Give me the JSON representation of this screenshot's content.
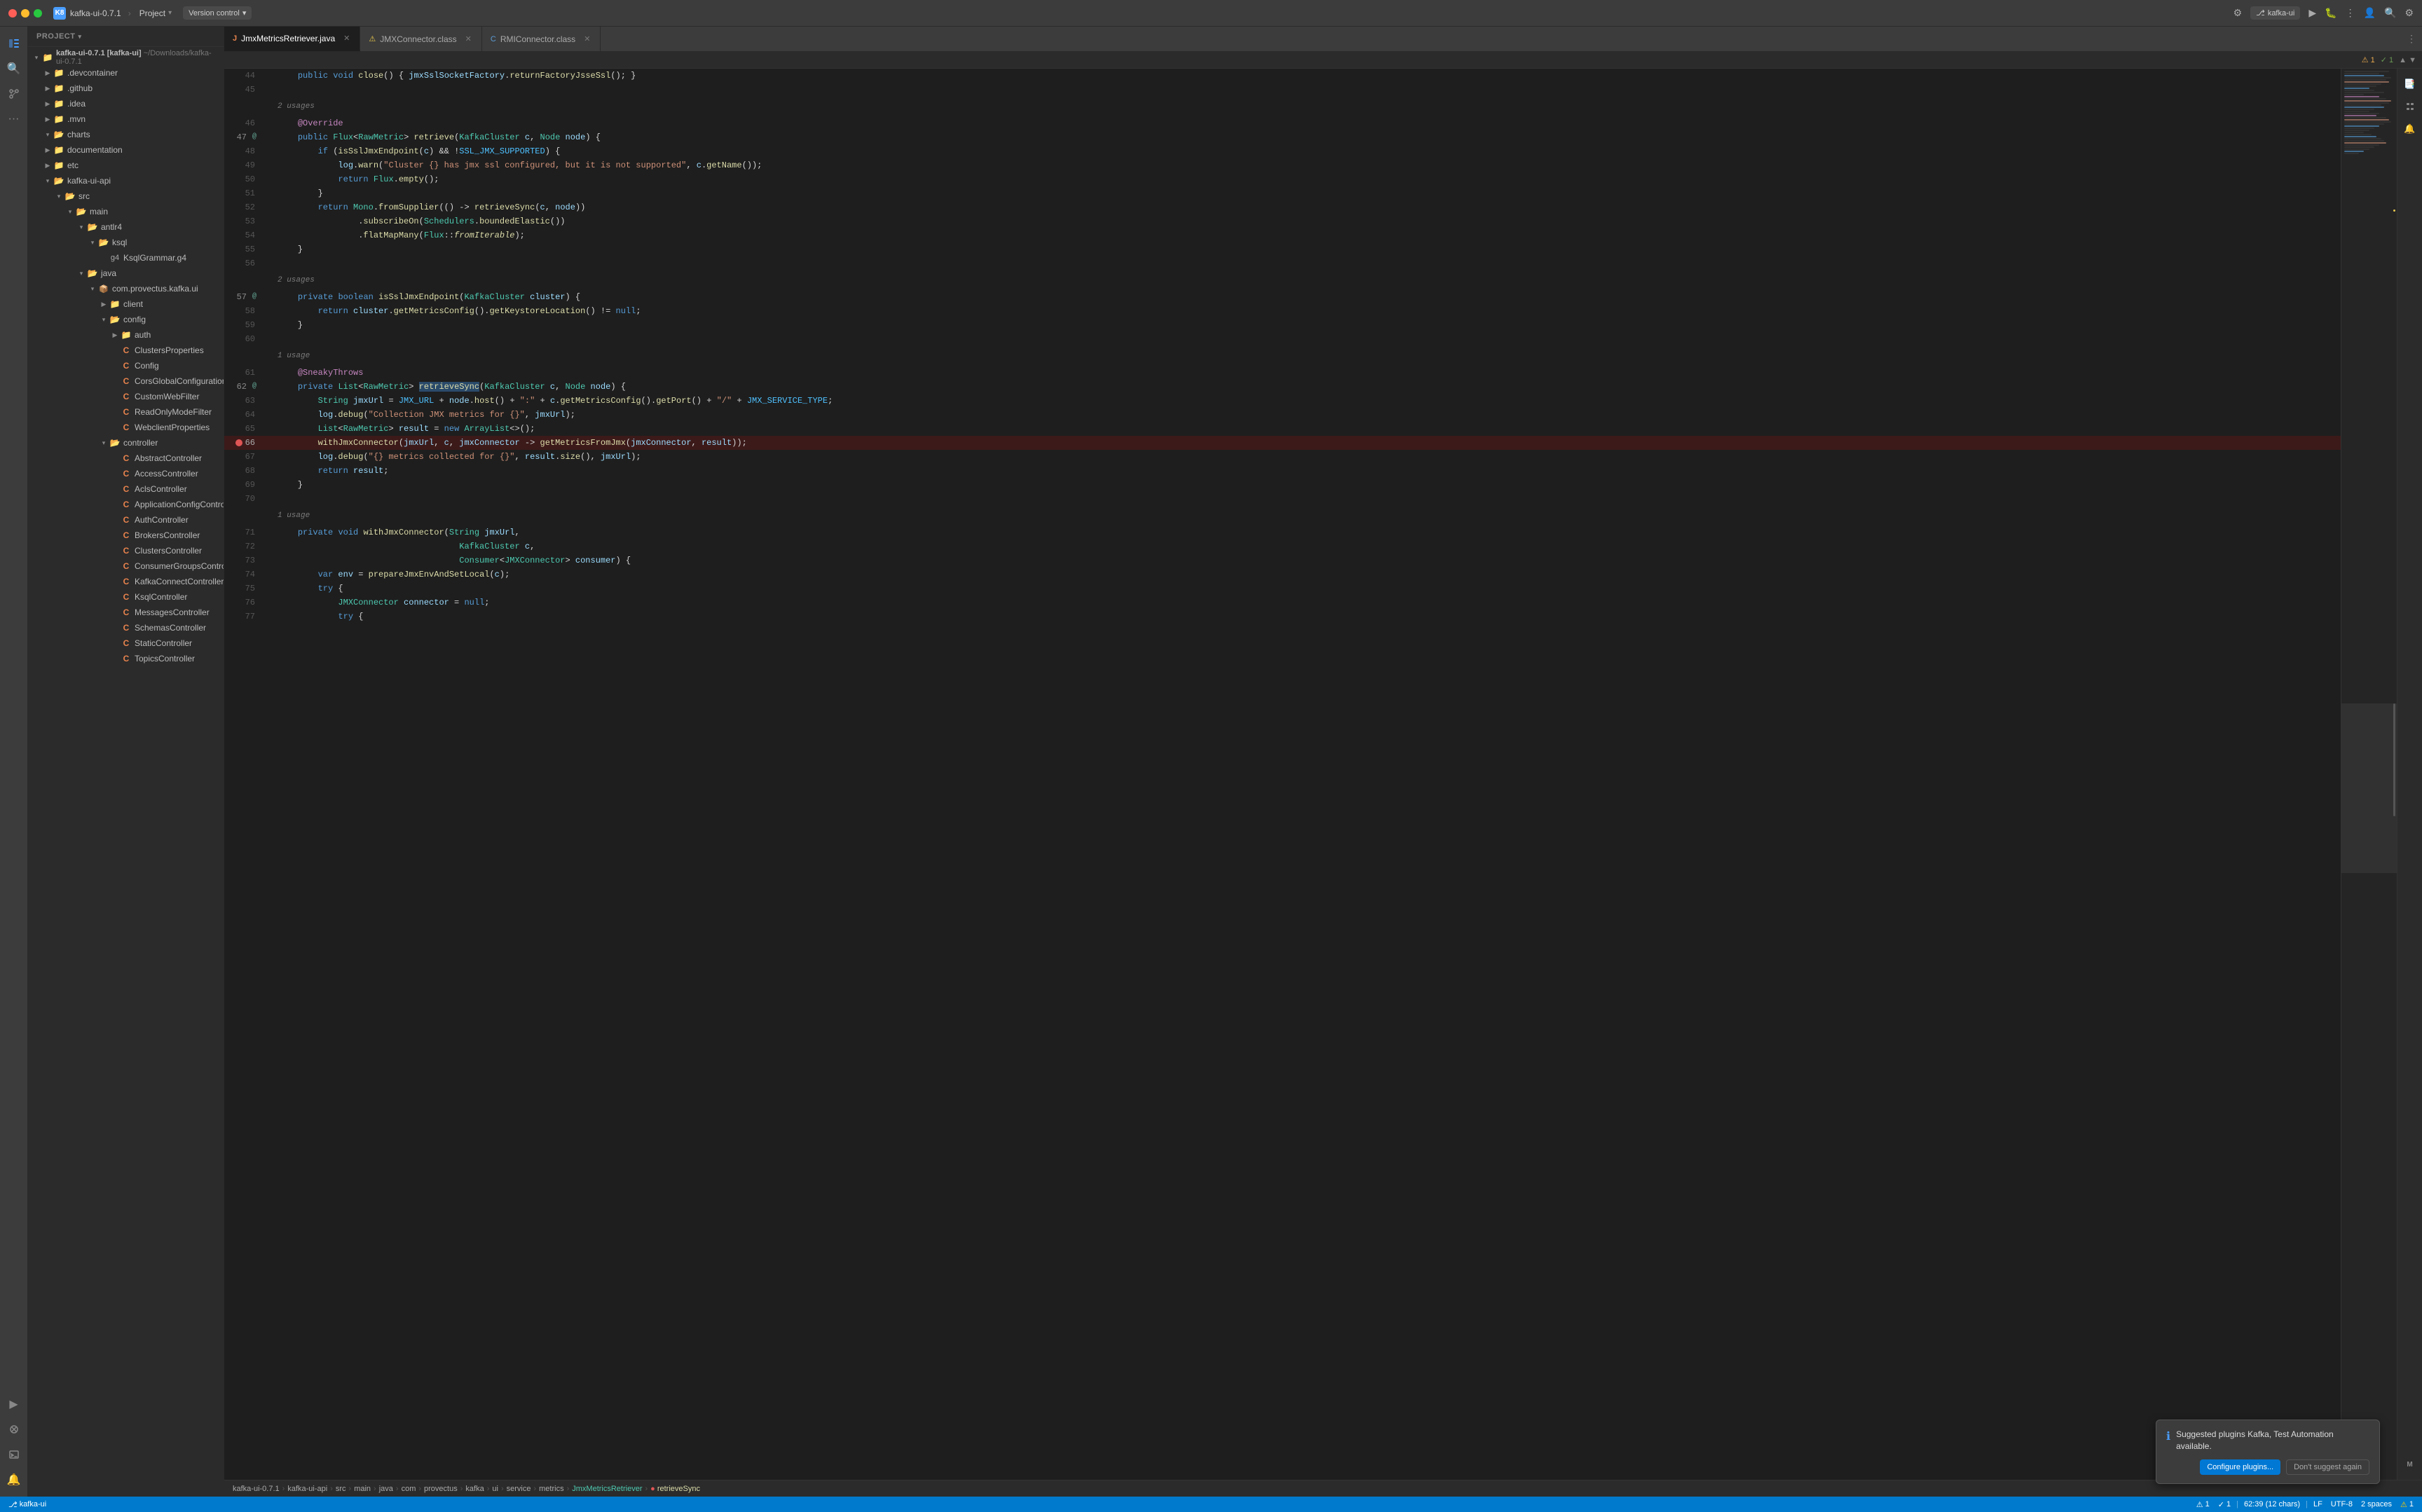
{
  "titlebar": {
    "app_name": "kafka-ui-0.7.1",
    "app_icon": "K8",
    "project_label": "Project",
    "vc_label": "Version control",
    "folder_icon": "📁"
  },
  "tabs": {
    "items": [
      {
        "id": "tab-jmxmetrics",
        "label": "JmxMetricsRetriever.java",
        "icon": "J",
        "active": true,
        "icon_color": "#e8834d"
      },
      {
        "id": "tab-jmxconnector",
        "label": "JMXConnector.class",
        "icon": "C",
        "active": false,
        "icon_color": "#5c9bd6"
      },
      {
        "id": "tab-rmiconnector",
        "label": "RMIConnector.class",
        "icon": "C",
        "active": false,
        "icon_color": "#5c9bd6"
      }
    ]
  },
  "notifications_bar": {
    "warning_count": "⚠ 1",
    "check_count": "✓ 1",
    "chevron_up": "▲",
    "chevron_down": "▼"
  },
  "sidebar": {
    "header_label": "Project",
    "root_item": "kafka-ui-0.7.1 [kafka-ui]",
    "root_path": "~/Downloads/kafka-ui-0.7.1",
    "items": [
      {
        "label": ".devcontainer",
        "type": "folder",
        "depth": 1,
        "collapsed": true
      },
      {
        "label": ".github",
        "type": "folder",
        "depth": 1,
        "collapsed": true
      },
      {
        "label": ".idea",
        "type": "folder",
        "depth": 1,
        "collapsed": true
      },
      {
        "label": ".mvn",
        "type": "folder",
        "depth": 1,
        "collapsed": true
      },
      {
        "label": "charts",
        "type": "folder",
        "depth": 1,
        "collapsed": false
      },
      {
        "label": "documentation",
        "type": "folder",
        "depth": 1,
        "collapsed": true
      },
      {
        "label": "etc",
        "type": "folder",
        "depth": 1,
        "collapsed": true
      },
      {
        "label": "kafka-ui-api",
        "type": "folder",
        "depth": 1,
        "collapsed": false
      },
      {
        "label": "src",
        "type": "folder",
        "depth": 2,
        "collapsed": false
      },
      {
        "label": "main",
        "type": "folder",
        "depth": 3,
        "collapsed": false
      },
      {
        "label": "antlr4",
        "type": "folder",
        "depth": 4,
        "collapsed": false
      },
      {
        "label": "ksql",
        "type": "folder",
        "depth": 5,
        "collapsed": false
      },
      {
        "label": "KsqlGrammar.g4",
        "type": "file",
        "depth": 6,
        "collapsed": false
      },
      {
        "label": "java",
        "type": "folder",
        "depth": 4,
        "collapsed": false
      },
      {
        "label": "com.provectus.kafka.ui",
        "type": "package",
        "depth": 5,
        "collapsed": false
      },
      {
        "label": "client",
        "type": "folder",
        "depth": 6,
        "collapsed": true
      },
      {
        "label": "config",
        "type": "folder",
        "depth": 6,
        "collapsed": false
      },
      {
        "label": "auth",
        "type": "folder",
        "depth": 7,
        "collapsed": true
      },
      {
        "label": "ClustersProperties",
        "type": "java",
        "depth": 7
      },
      {
        "label": "Config",
        "type": "java",
        "depth": 7
      },
      {
        "label": "CorsGlobalConfiguration",
        "type": "java",
        "depth": 7
      },
      {
        "label": "CustomWebFilter",
        "type": "java",
        "depth": 7
      },
      {
        "label": "ReadOnlyModeFilter",
        "type": "java",
        "depth": 7
      },
      {
        "label": "WebclientProperties",
        "type": "java",
        "depth": 7
      },
      {
        "label": "controller",
        "type": "folder",
        "depth": 6,
        "collapsed": false
      },
      {
        "label": "AbstractController",
        "type": "java",
        "depth": 7
      },
      {
        "label": "AccessController",
        "type": "java",
        "depth": 7
      },
      {
        "label": "AclsController",
        "type": "java",
        "depth": 7
      },
      {
        "label": "ApplicationConfigController",
        "type": "java",
        "depth": 7
      },
      {
        "label": "AuthController",
        "type": "java",
        "depth": 7
      },
      {
        "label": "BrokersController",
        "type": "java",
        "depth": 7
      },
      {
        "label": "ClustersController",
        "type": "java",
        "depth": 7
      },
      {
        "label": "ConsumerGroupsController",
        "type": "java",
        "depth": 7
      },
      {
        "label": "KafkaConnectController",
        "type": "java",
        "depth": 7
      },
      {
        "label": "KsqlController",
        "type": "java",
        "depth": 7
      },
      {
        "label": "MessagesController",
        "type": "java",
        "depth": 7
      },
      {
        "label": "SchemasController",
        "type": "java",
        "depth": 7
      },
      {
        "label": "StaticController",
        "type": "java",
        "depth": 7
      },
      {
        "label": "TopicsController",
        "type": "java",
        "depth": 7
      }
    ]
  },
  "code": {
    "lines": [
      {
        "num": 44,
        "content": "    public void close() { jmxSslSocketFactory.returnFactoryJsseSsl(); }",
        "type": "normal"
      },
      {
        "num": 45,
        "content": "",
        "type": "empty"
      },
      {
        "num": 46,
        "content": "    2 usages",
        "type": "usage"
      },
      {
        "num": 46,
        "content": "    @Override",
        "type": "annotation"
      },
      {
        "num": 47,
        "content": "    public Flux<RawMetric> retrieve(KafkaCluster c, Node node) {",
        "type": "method-sig"
      },
      {
        "num": 48,
        "content": "        if (isSslJmxEndpoint(c) && !SSL_JMX_SUPPORTED) {",
        "type": "normal"
      },
      {
        "num": 49,
        "content": "            log.warn(\"Cluster {} has jmx ssl configured, but it is not supported\", c.getName());",
        "type": "normal"
      },
      {
        "num": 50,
        "content": "            return Flux.empty();",
        "type": "normal"
      },
      {
        "num": 51,
        "content": "        }",
        "type": "normal"
      },
      {
        "num": 52,
        "content": "        return Mono.fromSupplier(() -> retrieveSync(c, node))",
        "type": "normal"
      },
      {
        "num": 53,
        "content": "                .subscribeOn(Schedulers.boundedElastic())",
        "type": "normal"
      },
      {
        "num": 54,
        "content": "                .flatMapMany(Flux::fromIterable);",
        "type": "normal"
      },
      {
        "num": 55,
        "content": "    }",
        "type": "normal"
      },
      {
        "num": 56,
        "content": "",
        "type": "empty"
      },
      {
        "num": 57,
        "content": "    2 usages",
        "type": "usage"
      },
      {
        "num": 57,
        "content": "    private boolean isSslJmxEndpoint(KafkaCluster cluster) {",
        "type": "normal"
      },
      {
        "num": 58,
        "content": "        return cluster.getMetricsConfig().getKeystoreLocation() != null;",
        "type": "normal"
      },
      {
        "num": 59,
        "content": "    }",
        "type": "normal"
      },
      {
        "num": 60,
        "content": "",
        "type": "empty"
      },
      {
        "num": 61,
        "content": "    1 usage",
        "type": "usage"
      },
      {
        "num": 61,
        "content": "    @SneakyThrows",
        "type": "annotation"
      },
      {
        "num": 62,
        "content": "    private List<RawMetric> retrieveSync(KafkaCluster c, Node node) {",
        "type": "normal"
      },
      {
        "num": 63,
        "content": "        String jmxUrl = JMX_URL + node.host() + \":\" + c.getMetricsConfig().getPort() + \"/\" + JMX_SERVICE_TYPE;",
        "type": "normal"
      },
      {
        "num": 64,
        "content": "        log.debug(\"Collection JMX metrics for {}\", jmxUrl);",
        "type": "normal"
      },
      {
        "num": 65,
        "content": "        List<RawMetric> result = new ArrayList<>();",
        "type": "normal"
      },
      {
        "num": 66,
        "content": "        withJmxConnector(jmxUrl, c, jmxConnector -> getMetricsFromJmx(jmxConnector, result));",
        "type": "breakpoint"
      },
      {
        "num": 67,
        "content": "        log.debug(\"{} metrics collected for {}\", result.size(), jmxUrl);",
        "type": "normal"
      },
      {
        "num": 68,
        "content": "        return result;",
        "type": "normal"
      },
      {
        "num": 69,
        "content": "    }",
        "type": "normal"
      },
      {
        "num": 70,
        "content": "",
        "type": "empty"
      },
      {
        "num": 71,
        "content": "    1 usage",
        "type": "usage"
      },
      {
        "num": 71,
        "content": "    private void withJmxConnector(String jmxUrl,",
        "type": "normal"
      },
      {
        "num": 72,
        "content": "                                    KafkaCluster c,",
        "type": "normal"
      },
      {
        "num": 73,
        "content": "                                    Consumer<JMXConnector> consumer) {",
        "type": "normal"
      },
      {
        "num": 74,
        "content": "        var env = prepareJmxEnvAndSetLocal(c);",
        "type": "normal"
      },
      {
        "num": 75,
        "content": "        try {",
        "type": "normal"
      },
      {
        "num": 76,
        "content": "            JMXConnector connector = null;",
        "type": "normal"
      },
      {
        "num": 77,
        "content": "            try {",
        "type": "normal"
      }
    ]
  },
  "breadcrumb": {
    "items": [
      "kafka-ui-0.7.1",
      "kafka-ui-api",
      "src",
      "main",
      "java",
      "com",
      "provectus",
      "kafka",
      "ui",
      "service",
      "metrics",
      "JmxMetricsRetriever",
      "retrieveSync"
    ],
    "separator": "›"
  },
  "status_bar": {
    "position": "62:39 (12 chars)",
    "encoding": "UTF-8",
    "line_ending": "LF",
    "indent": "2 spaces",
    "branch": "kafka-ui",
    "warning_icon": "⚠",
    "warnings": "1"
  },
  "popup": {
    "icon": "ℹ",
    "title": "Suggested plugins Kafka, Test Automation available.",
    "btn_configure": "Configure plugins...",
    "btn_dismiss": "Don't suggest again"
  },
  "colors": {
    "accent": "#4a9eff",
    "background": "#1e1e1e",
    "sidebar_bg": "#2b2b2b",
    "tab_active_bg": "#1e1e1e",
    "status_bar_bg": "#007acc",
    "breakpoint": "#e05555"
  }
}
